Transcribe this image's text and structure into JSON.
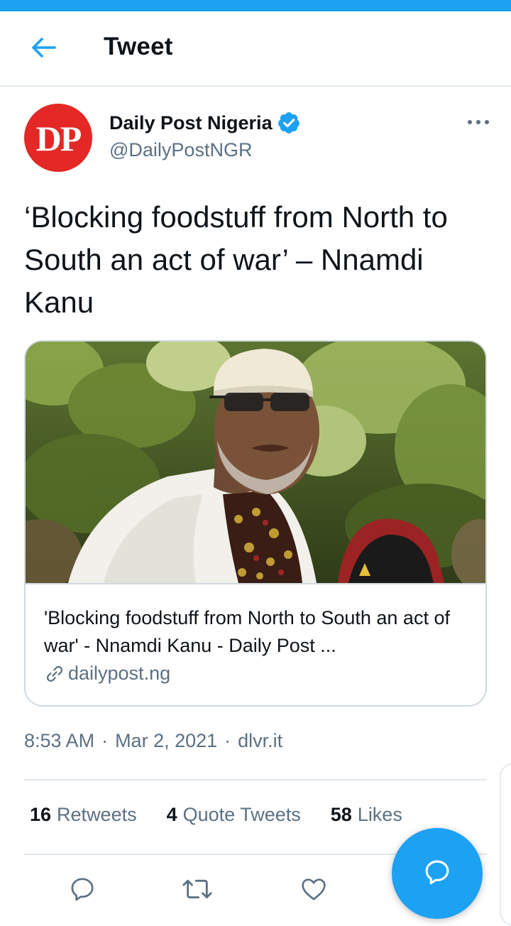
{
  "colors": {
    "accent": "#1da1f2",
    "text": "#0f1419",
    "secondary": "#5b7083",
    "brand_red": "#e32826"
  },
  "header": {
    "title": "Tweet",
    "back_icon": "arrow-left-icon"
  },
  "author": {
    "avatar_text": "DP",
    "display_name": "Daily Post Nigeria",
    "handle": "@DailyPostNGR",
    "verified": true,
    "more_icon": "more-horizontal-icon"
  },
  "tweet": {
    "text": "‘Blocking foodstuff from North to South an act of war’ – Nnamdi Kanu"
  },
  "card": {
    "image_alt": "Photo of a man in a white cap and glasses outdoors under trees",
    "title": "'Blocking foodstuff from North to South an act of war' - Nnamdi Kanu - Daily Post ...",
    "domain": "dailypost.ng",
    "link_icon": "link-icon"
  },
  "meta": {
    "time": "8:53 AM",
    "date": "Mar 2, 2021",
    "source": "dlvr.it",
    "separator": "·"
  },
  "stats": {
    "retweets_count": "16",
    "retweets_label": "Retweets",
    "quotes_count": "4",
    "quotes_label": "Quote Tweets",
    "likes_count": "58",
    "likes_label": "Likes"
  },
  "actions": {
    "reply_icon": "reply-icon",
    "retweet_icon": "retweet-icon",
    "like_icon": "heart-icon",
    "compose_icon": "compose-reply-icon"
  }
}
